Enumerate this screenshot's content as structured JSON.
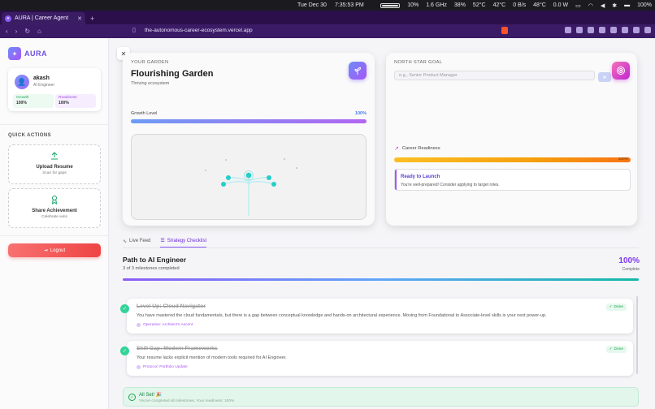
{
  "menubar": {
    "date": "Tue Dec 30",
    "time": "7:35:53 PM",
    "cpu": "10%",
    "freq": "1.6 GHz",
    "mem": "38%",
    "temp1": "52°C",
    "temp2": "42°C",
    "net": "0 B/s",
    "temp3": "48°C",
    "power": "0.0 W",
    "battery": "100%",
    "battery_level": 1.0
  },
  "browser": {
    "tab_title": "AURA | Career Agent",
    "url": "the-autonomous-career-ecosystem.vercel.app"
  },
  "sidebar": {
    "logo": "AURA",
    "profile": {
      "initial": "👤",
      "name": "akash",
      "role": "AI Engineer",
      "growth_label": "Growth",
      "growth_value": "100%",
      "readiness_label": "Readiness",
      "readiness_value": "100%"
    },
    "quick_actions_title": "QUICK ACTIONS",
    "actions": [
      {
        "icon": "upload-icon",
        "label": "Upload Resume",
        "sub": "Scan for gaps"
      },
      {
        "icon": "award-icon",
        "label": "Share Achievement",
        "sub": "Celebrate wins"
      }
    ],
    "logout_label": "Logout"
  },
  "garden": {
    "eyebrow": "YOUR GARDEN",
    "title": "Flourishing Garden",
    "subtitle": "Thriving ecosystem",
    "level_label": "Growth Level",
    "level_value": "100%",
    "level_fraction": 1.0
  },
  "goal": {
    "eyebrow": "NORTH STAR GOAL",
    "placeholder": "e.g., Senior Product Manager",
    "readiness_label": "Career Readiness",
    "readiness_value": "100%",
    "readiness_fraction": 1.0,
    "launch_title": "Ready to Launch",
    "launch_text": "You're well-prepared! Consider applying to target roles."
  },
  "tabs": [
    {
      "label": "Live Feed",
      "icon": "activity-icon",
      "active": false
    },
    {
      "label": "Strategy Checklist",
      "icon": "list-icon",
      "active": true
    }
  ],
  "path": {
    "title": "Path to AI Engineer",
    "subtitle": "3 of 3 milestones completed",
    "percent": "100%",
    "percent_label": "Complete",
    "fraction": 1.0
  },
  "milestones": [
    {
      "title": "Level Up: Cloud Navigator",
      "body": "You have mastered the cloud fundamentals, but there is a gap between conceptual knowledge and hands-on architectural experience. Moving from Foundational to Associate-level skills is your next power-up.",
      "op": "Operation: Architect's Ascent",
      "badge": "Done"
    },
    {
      "title": "Skill Gap: Modern Frameworks",
      "body": "Your resume lacks explicit mention of modern tools required for AI Engineer.",
      "op": "Protocol: Portfolio Update",
      "badge": "Done"
    }
  ],
  "all_set": {
    "title": "All Set! 🎉",
    "subtitle": "You've completed all milestones. Your readiness: 100%"
  },
  "colors": {
    "accent": "#7c3aed",
    "success": "#16a34a",
    "warning": "#f59e0b",
    "danger": "#ef4444"
  }
}
